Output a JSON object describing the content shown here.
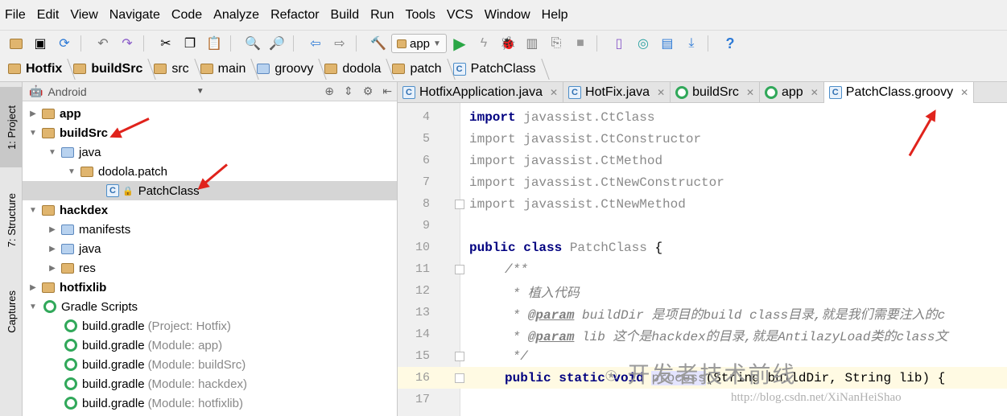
{
  "menu": [
    "File",
    "Edit",
    "View",
    "Navigate",
    "Code",
    "Analyze",
    "Refactor",
    "Build",
    "Run",
    "Tools",
    "VCS",
    "Window",
    "Help"
  ],
  "toolbar": {
    "run_config": "app"
  },
  "breadcrumb": [
    "Hotfix",
    "buildSrc",
    "src",
    "main",
    "groovy",
    "dodola",
    "patch",
    "PatchClass"
  ],
  "side_tabs": {
    "project": "1: Project",
    "structure": "7: Structure",
    "captures": "Captures"
  },
  "project_panel": {
    "view_mode": "Android",
    "tree": [
      {
        "label": "app",
        "note": ""
      },
      {
        "label": "buildSrc",
        "note": ""
      },
      {
        "label": "java",
        "note": ""
      },
      {
        "label": "dodola.patch",
        "note": ""
      },
      {
        "label": "PatchClass",
        "note": ""
      },
      {
        "label": "hackdex",
        "note": ""
      },
      {
        "label": "manifests",
        "note": ""
      },
      {
        "label": "java",
        "note": ""
      },
      {
        "label": "res",
        "note": ""
      },
      {
        "label": "hotfixlib",
        "note": ""
      },
      {
        "label": "Gradle Scripts",
        "note": ""
      },
      {
        "label": "build.gradle",
        "note": "(Project: Hotfix)"
      },
      {
        "label": "build.gradle",
        "note": "(Module: app)"
      },
      {
        "label": "build.gradle",
        "note": "(Module: buildSrc)"
      },
      {
        "label": "build.gradle",
        "note": "(Module: hackdex)"
      },
      {
        "label": "build.gradle",
        "note": "(Module: hotfixlib)"
      }
    ]
  },
  "editor_tabs": [
    "HotfixApplication.java",
    "HotFix.java",
    "buildSrc",
    "app",
    "PatchClass.groovy"
  ],
  "code": {
    "line_numbers": [
      "4",
      "5",
      "6",
      "7",
      "8",
      "9",
      "10",
      "11",
      "12",
      "13",
      "14",
      "15",
      "16",
      "17"
    ],
    "import_kw": "import",
    "imports": [
      "javassist.CtClass",
      "javassist.CtConstructor",
      "javassist.CtMethod",
      "javassist.CtNewConstructor",
      "javassist.CtNewMethod"
    ],
    "class_decl_kw": "public class",
    "class_name": "PatchClass",
    "class_brace": " {",
    "doc_open": "/**",
    "doc_line1": " * 植入代码",
    "doc_star": " * ",
    "param_tag": "@param",
    "doc_param1": " buildDir 是项目的build class目录,就是我们需要注入的c",
    "doc_param2": " lib 这个是hackdex的目录,就是AntilazyLoad类的class文",
    "doc_close": " */",
    "method_kw": "public static void",
    "method_name": "process",
    "method_rest": "(String buildDir, String lib) {"
  },
  "watermark": {
    "text": "开发者技术前线",
    "url": "http://blog.csdn.net/XiNanHeiShao"
  },
  "colors": {
    "keyword": "#000080",
    "comment": "#808080",
    "annotation_arrow": "#e0231c",
    "current_line": "#fffae3"
  }
}
